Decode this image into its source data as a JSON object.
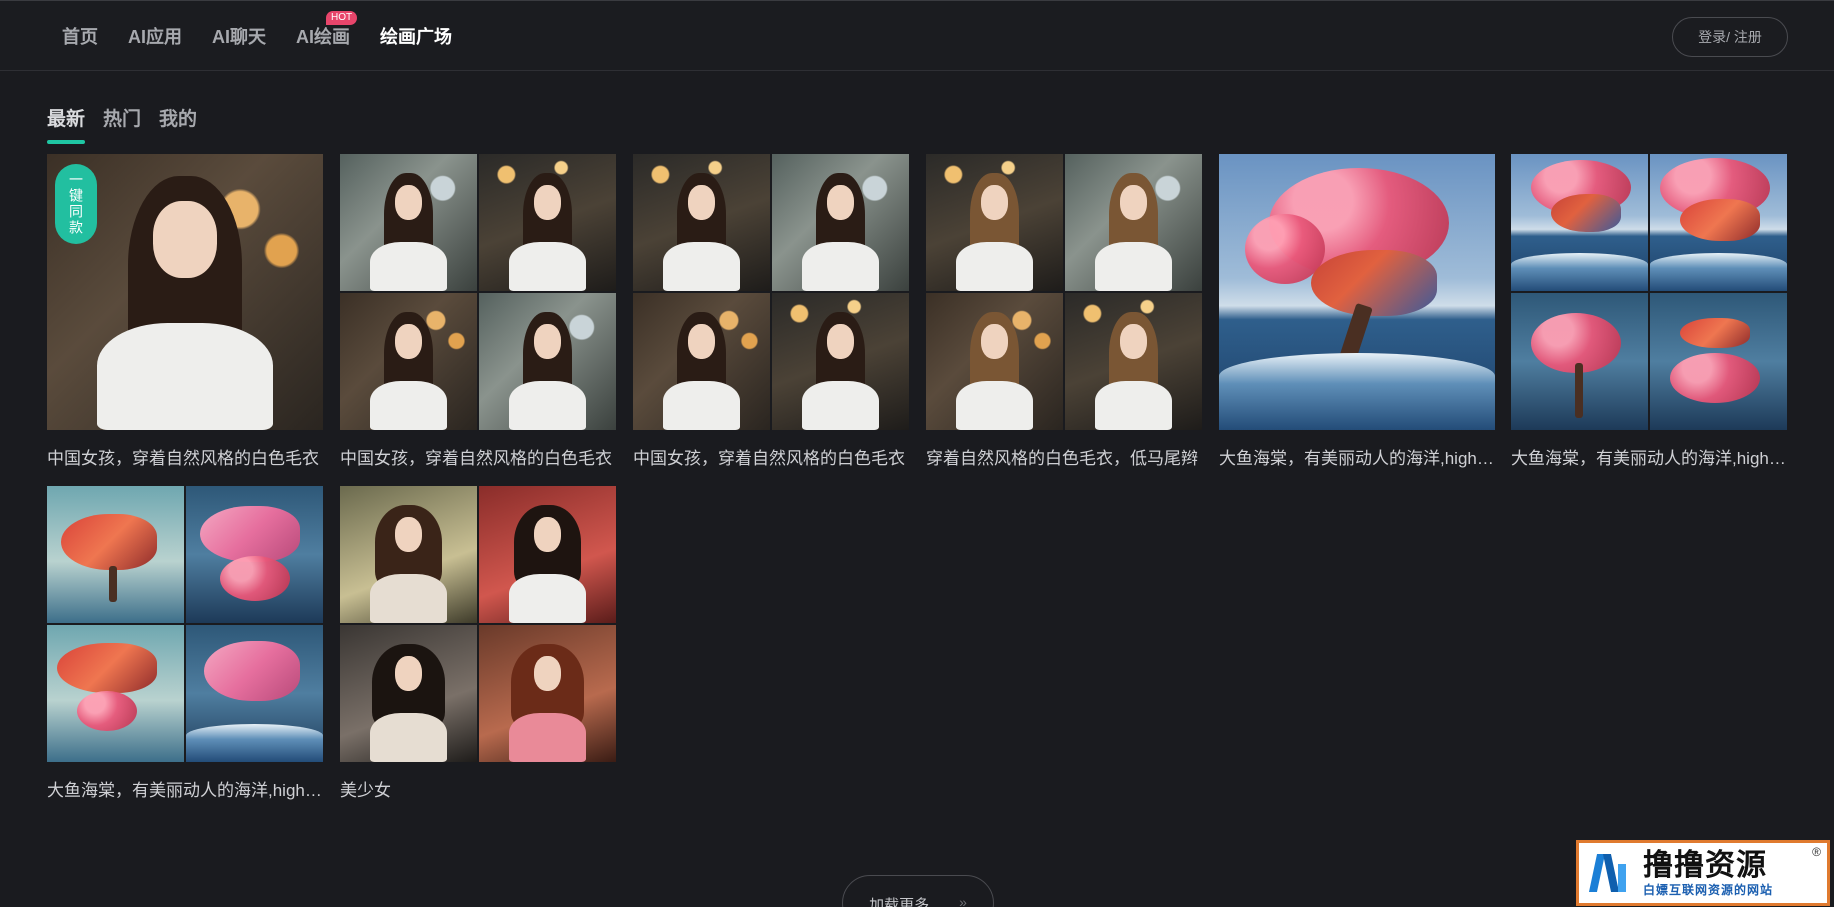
{
  "nav": {
    "items": [
      {
        "label": "首页"
      },
      {
        "label": "AI应用"
      },
      {
        "label": "AI聊天"
      },
      {
        "label": "AI绘画",
        "badge": "HOT"
      },
      {
        "label": "绘画广场",
        "active": true
      }
    ],
    "login_label": "登录/ 注册"
  },
  "tabs": [
    {
      "label": "最新",
      "active": true
    },
    {
      "label": "热门"
    },
    {
      "label": "我的"
    }
  ],
  "gallery": [
    {
      "caption": "中国女孩，穿着自然风格的白色毛衣",
      "badge": "一键同款"
    },
    {
      "caption": "中国女孩，穿着自然风格的白色毛衣"
    },
    {
      "caption": "中国女孩，穿着自然风格的白色毛衣"
    },
    {
      "caption": "穿着自然风格的白色毛衣，低马尾辫"
    },
    {
      "caption": "大鱼海棠，有美丽动人的海洋,high detail"
    },
    {
      "caption": "大鱼海棠，有美丽动人的海洋,high detail"
    },
    {
      "caption": "大鱼海棠，有美丽动人的海洋,high detail"
    },
    {
      "caption": "美少女"
    }
  ],
  "load_more_label": "加载更多",
  "watermark": {
    "title": "撸撸资源",
    "subtitle": "白嫖互联网资源的网站",
    "reg": "®"
  },
  "colors": {
    "background": "#1a1b1f",
    "accent": "#1fc6a3",
    "hot_badge": "#e8456b",
    "watermark_border": "#e07a2f"
  }
}
